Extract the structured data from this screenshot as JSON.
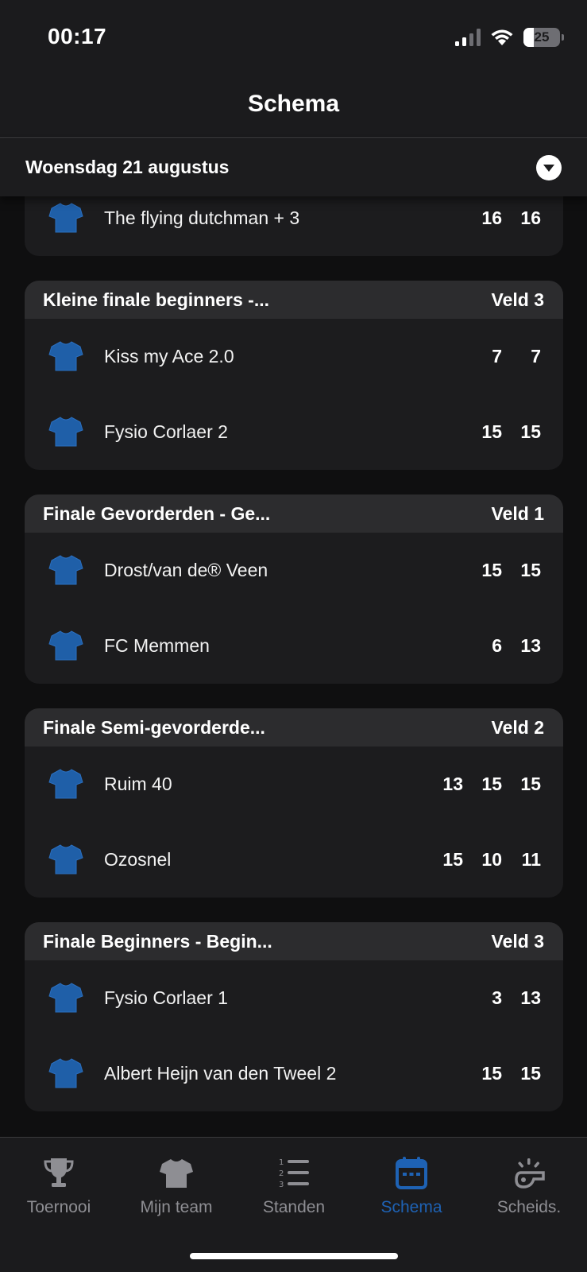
{
  "status": {
    "time": "00:17",
    "battery": "25"
  },
  "header": {
    "title": "Schema"
  },
  "date_bar": {
    "label": "Woensdag 21 augustus"
  },
  "colors": {
    "accent": "#1e62b4",
    "shirt": "#1f5fa8",
    "background": "#0f0f10",
    "card": "#1c1c1e",
    "card_header": "#2c2c2e"
  },
  "matches": [
    {
      "teams": [
        {
          "name": "The flying dutchman + 3",
          "scores": [
            "16",
            "16"
          ]
        }
      ]
    },
    {
      "title": "Kleine finale beginners -...",
      "field": "Veld 3",
      "teams": [
        {
          "name": "Kiss my Ace 2.0",
          "scores": [
            "7",
            "7"
          ]
        },
        {
          "name": "Fysio Corlaer 2",
          "scores": [
            "15",
            "15"
          ]
        }
      ]
    },
    {
      "title": "Finale Gevorderden - Ge...",
      "field": "Veld 1",
      "teams": [
        {
          "name": "Drost/van de® Veen",
          "scores": [
            "15",
            "15"
          ]
        },
        {
          "name": "FC Memmen",
          "scores": [
            "6",
            "13"
          ]
        }
      ]
    },
    {
      "title": "Finale Semi-gevorderde...",
      "field": "Veld 2",
      "teams": [
        {
          "name": "Ruim 40",
          "scores": [
            "13",
            "15",
            "15"
          ]
        },
        {
          "name": "Ozosnel",
          "scores": [
            "15",
            "10",
            "11"
          ]
        }
      ]
    },
    {
      "title": "Finale Beginners - Begin...",
      "field": "Veld 3",
      "teams": [
        {
          "name": "Fysio Corlaer 1",
          "scores": [
            "3",
            "13"
          ]
        },
        {
          "name": "Albert Heijn van den Tweel 2",
          "scores": [
            "15",
            "15"
          ]
        }
      ]
    }
  ],
  "tabs": [
    {
      "label": "Toernooi",
      "icon": "trophy-icon",
      "active": false
    },
    {
      "label": "Mijn team",
      "icon": "shirt-icon",
      "active": false
    },
    {
      "label": "Standen",
      "icon": "ranked-list-icon",
      "active": false
    },
    {
      "label": "Schema",
      "icon": "calendar-icon",
      "active": true
    },
    {
      "label": "Scheids.",
      "icon": "whistle-icon",
      "active": false
    }
  ]
}
